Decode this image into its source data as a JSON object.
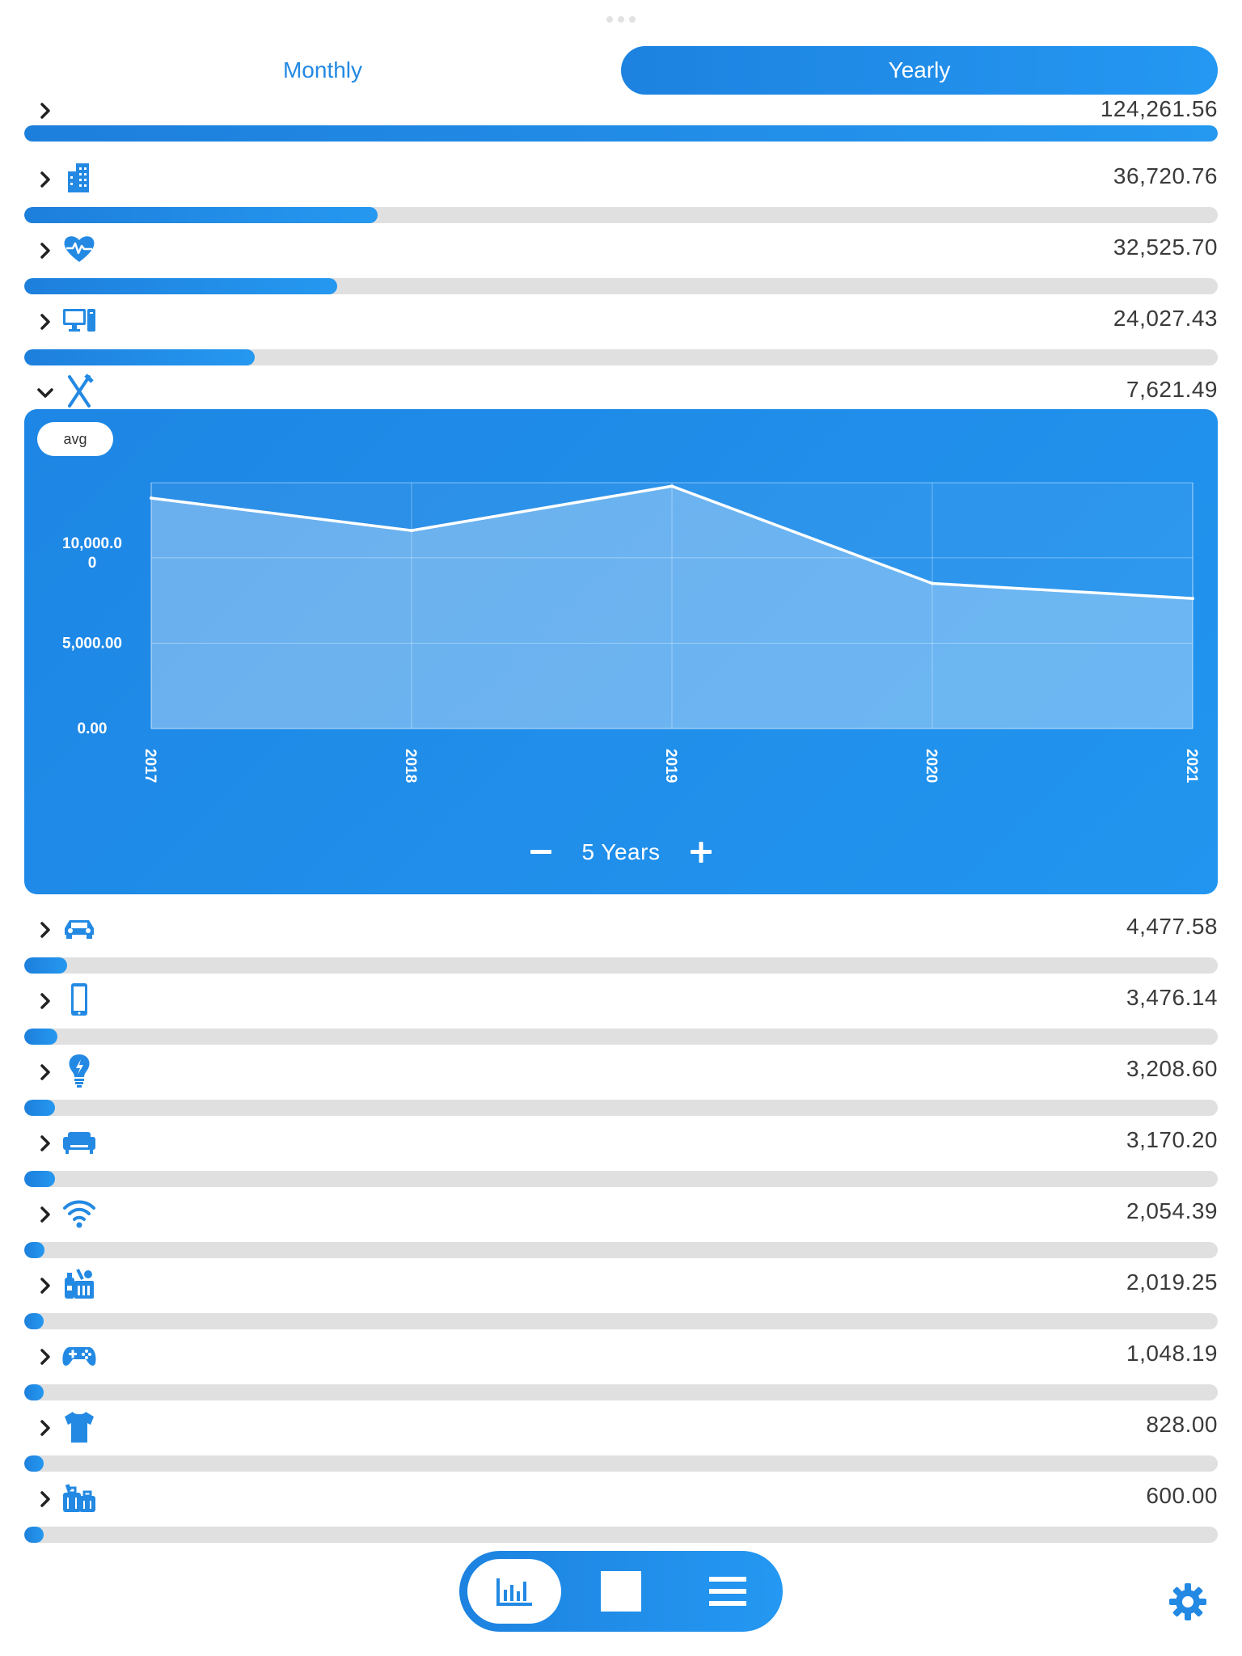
{
  "tabs": {
    "monthly": "Monthly",
    "yearly": "Yearly",
    "selected": "Yearly"
  },
  "total": {
    "amount": "124,261.56",
    "fraction": 1.0
  },
  "categories": [
    {
      "icon": "building-icon",
      "amount": "36,720.76",
      "fraction": 0.296
    },
    {
      "icon": "heart-pulse-icon",
      "amount": "32,525.70",
      "fraction": 0.262
    },
    {
      "icon": "computer-icon",
      "amount": "24,027.43",
      "fraction": 0.193
    },
    {
      "icon": "fork-knife-icon",
      "amount": "7,621.49",
      "fraction": 0.061,
      "expanded": true
    },
    {
      "icon": "car-icon",
      "amount": "4,477.58",
      "fraction": 0.036
    },
    {
      "icon": "smartphone-icon",
      "amount": "3,476.14",
      "fraction": 0.028
    },
    {
      "icon": "lightbulb-icon",
      "amount": "3,208.60",
      "fraction": 0.026
    },
    {
      "icon": "sofa-icon",
      "amount": "3,170.20",
      "fraction": 0.026
    },
    {
      "icon": "wifi-icon",
      "amount": "2,054.39",
      "fraction": 0.017
    },
    {
      "icon": "groceries-icon",
      "amount": "2,019.25",
      "fraction": 0.016
    },
    {
      "icon": "gamepad-icon",
      "amount": "1,048.19",
      "fraction": 0.008
    },
    {
      "icon": "tshirt-icon",
      "amount": "828.00",
      "fraction": 0.007
    },
    {
      "icon": "luggage-icon",
      "amount": "600.00",
      "fraction": 0.005
    }
  ],
  "detail": {
    "avg_label": "avg",
    "range_label": "5 Years"
  },
  "chart_data": {
    "type": "area",
    "x": [
      "2017",
      "2018",
      "2019",
      "2020",
      "2021"
    ],
    "series": [
      {
        "values": [
          13500,
          11600,
          14200,
          8500,
          7621.49
        ]
      }
    ],
    "ylim": [
      0,
      14400
    ],
    "yticks": [
      {
        "value": 0,
        "label": "0.00"
      },
      {
        "value": 5000,
        "label": "5,000.00"
      },
      {
        "value": 10000,
        "label": "10,000.0\n0"
      }
    ],
    "grid": true
  },
  "bottom_bar": {
    "selected": "chart-icon",
    "items": [
      "chart-icon",
      "square-icon",
      "list-icon"
    ]
  },
  "colors": {
    "accent": "#2389e3",
    "track": "#e0e0e0",
    "panel": "#1e86e4"
  }
}
